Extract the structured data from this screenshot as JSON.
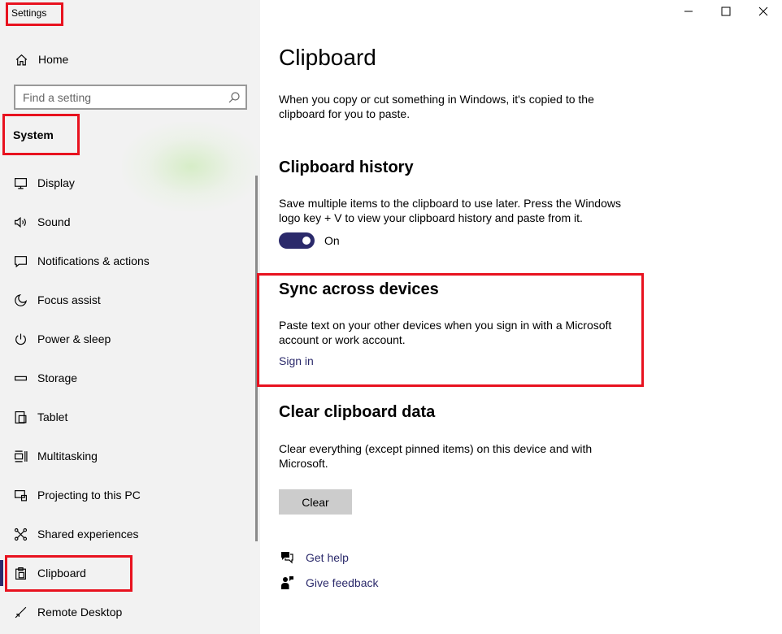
{
  "window": {
    "title": "Settings",
    "controls": {
      "minimize_icon": "minimize-icon",
      "maximize_icon": "maximize-icon",
      "close_icon": "close-icon"
    }
  },
  "sidebar": {
    "home_label": "Home",
    "search_placeholder": "Find a setting",
    "section_header": "System",
    "items": [
      {
        "label": "Display",
        "icon": "display-icon"
      },
      {
        "label": "Sound",
        "icon": "sound-icon"
      },
      {
        "label": "Notifications & actions",
        "icon": "notifications-icon"
      },
      {
        "label": "Focus assist",
        "icon": "moon-icon"
      },
      {
        "label": "Power & sleep",
        "icon": "power-icon"
      },
      {
        "label": "Storage",
        "icon": "storage-icon"
      },
      {
        "label": "Tablet",
        "icon": "tablet-icon"
      },
      {
        "label": "Multitasking",
        "icon": "multitasking-icon"
      },
      {
        "label": "Projecting to this PC",
        "icon": "projecting-icon"
      },
      {
        "label": "Shared experiences",
        "icon": "shared-experiences-icon"
      },
      {
        "label": "Clipboard",
        "icon": "clipboard-icon",
        "selected": true
      },
      {
        "label": "Remote Desktop",
        "icon": "remote-desktop-icon"
      }
    ]
  },
  "main": {
    "title": "Clipboard",
    "intro": "When you copy or cut something in Windows, it's copied to the clipboard for you to paste.",
    "history": {
      "title": "Clipboard history",
      "description": "Save multiple items to the clipboard to use later. Press the Windows logo key + V to view your clipboard history and paste from it.",
      "toggle_state": "On"
    },
    "sync": {
      "title": "Sync across devices",
      "description": "Paste text on your other devices when you sign in with a Microsoft account or work account.",
      "sign_in_link": "Sign in"
    },
    "clear": {
      "title": "Clear clipboard data",
      "description": "Clear everything (except pinned items) on this device and with Microsoft.",
      "button_label": "Clear"
    },
    "help": {
      "get_help": "Get help",
      "give_feedback": "Give feedback"
    }
  },
  "colors": {
    "accent": "#2b2a6b",
    "annotation_red": "#e8121f",
    "sidebar_bg": "#f2f2f2",
    "button_bg": "#cccccc"
  }
}
